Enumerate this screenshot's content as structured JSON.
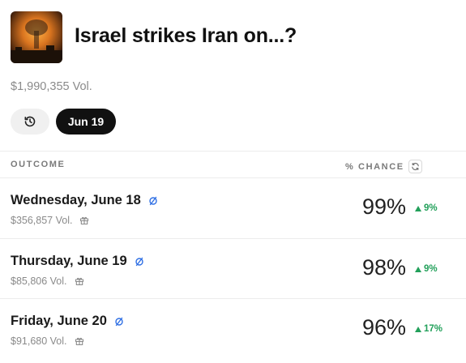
{
  "header": {
    "title": "Israel strikes Iran on...?",
    "volume": "$1,990,355 Vol."
  },
  "controls": {
    "history_icon": "history-icon",
    "date_pill": "Jun 19"
  },
  "columns": {
    "outcome": "OUTCOME",
    "chance": "% CHANCE"
  },
  "colors": {
    "accent_up": "#22a05a",
    "pill_bg": "#111111",
    "resolve_icon": "#2f6fe4"
  },
  "outcomes": [
    {
      "label": "Wednesday, June 18",
      "volume": "$356,857 Vol.",
      "chance": "99%",
      "change": "9%"
    },
    {
      "label": "Thursday, June 19",
      "volume": "$85,806 Vol.",
      "chance": "98%",
      "change": "9%"
    },
    {
      "label": "Friday, June 20",
      "volume": "$91,680 Vol.",
      "chance": "96%",
      "change": "17%"
    }
  ]
}
